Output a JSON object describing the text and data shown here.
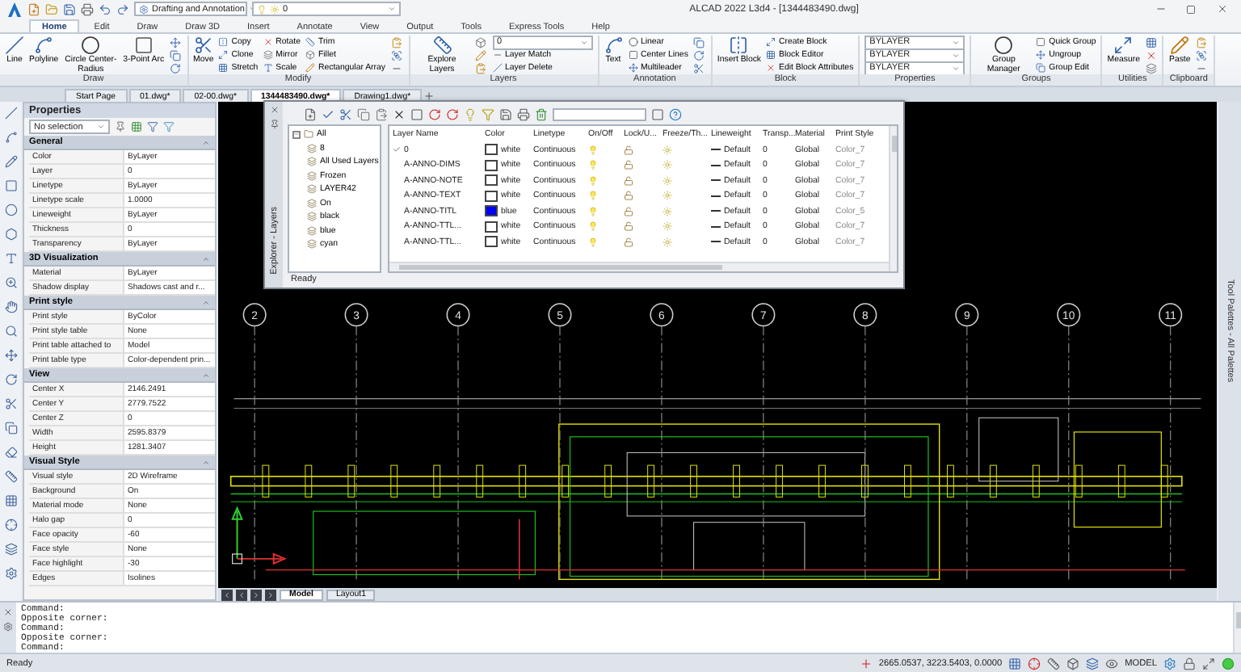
{
  "title_bar": {
    "workspace": "Drafting and Annotation",
    "layer": "0",
    "title": "ALCAD 2022 L3d4 - [1344483490.dwg]"
  },
  "menu_tabs": [
    {
      "label": "Home",
      "selected": true
    },
    {
      "label": "Edit",
      "selected": false
    },
    {
      "label": "Draw",
      "selected": false
    },
    {
      "label": "Draw 3D",
      "selected": false
    },
    {
      "label": "Insert",
      "selected": false
    },
    {
      "label": "Annotate",
      "selected": false
    },
    {
      "label": "View",
      "selected": false
    },
    {
      "label": "Output",
      "selected": false
    },
    {
      "label": "Tools",
      "selected": false
    },
    {
      "label": "Express Tools",
      "selected": false
    },
    {
      "label": "Help",
      "selected": false
    }
  ],
  "ribbon": [
    {
      "title": "Draw",
      "tools": [
        {
          "kind": "large",
          "label": "Line"
        },
        {
          "kind": "large",
          "label": "Polyline"
        },
        {
          "kind": "large",
          "label": "Circle Center-Radius"
        },
        {
          "kind": "large",
          "label": "3-Point Arc"
        },
        {
          "kind": "icon"
        },
        {
          "kind": "icon"
        },
        {
          "kind": "icon"
        }
      ]
    },
    {
      "title": "Modify",
      "tools": [
        {
          "kind": "large",
          "label": "Move"
        },
        {
          "kind": "small",
          "label": "Copy"
        },
        {
          "kind": "small",
          "label": "Clone"
        },
        {
          "kind": "small",
          "label": "Stretch"
        },
        {
          "kind": "small",
          "label": "Rotate"
        },
        {
          "kind": "small",
          "label": "Mirror"
        },
        {
          "kind": "small",
          "label": "Scale"
        },
        {
          "kind": "small",
          "label": "Trim"
        },
        {
          "kind": "small",
          "label": "Fillet"
        },
        {
          "kind": "small",
          "label": "Rectangular Array"
        },
        {
          "kind": "icon"
        },
        {
          "kind": "icon"
        },
        {
          "kind": "icon"
        }
      ]
    },
    {
      "title": "Layers",
      "tools": [
        {
          "kind": "large",
          "label": "Explore Layers"
        },
        {
          "kind": "icon"
        },
        {
          "kind": "icon"
        },
        {
          "kind": "icon"
        },
        {
          "kind": "dropdown",
          "label": "0"
        },
        {
          "kind": "small",
          "label": "Layer Match"
        },
        {
          "kind": "small",
          "label": "Layer Delete"
        }
      ]
    },
    {
      "title": "Annotation",
      "tools": [
        {
          "kind": "large",
          "label": "Text"
        },
        {
          "kind": "small",
          "label": "Linear"
        },
        {
          "kind": "small",
          "label": "Center Lines"
        },
        {
          "kind": "small",
          "label": "Multileader"
        },
        {
          "kind": "icon"
        },
        {
          "kind": "icon"
        },
        {
          "kind": "icon"
        }
      ]
    },
    {
      "title": "Block",
      "tools": [
        {
          "kind": "large",
          "label": "Insert Block"
        },
        {
          "kind": "small",
          "label": "Create Block"
        },
        {
          "kind": "small",
          "label": "Block Editor"
        },
        {
          "kind": "small",
          "label": "Edit Block Attributes"
        }
      ]
    },
    {
      "title": "Properties",
      "tools": [
        {
          "kind": "dropdown",
          "label": "BYLAYER"
        },
        {
          "kind": "dropdown",
          "label": "BYLAYER"
        },
        {
          "kind": "dropdown",
          "label": "BYLAYER"
        }
      ]
    },
    {
      "title": "Groups",
      "tools": [
        {
          "kind": "large",
          "label": "Group Manager"
        },
        {
          "kind": "small",
          "label": "Quick Group"
        },
        {
          "kind": "small",
          "label": "Ungroup"
        },
        {
          "kind": "small",
          "label": "Group Edit"
        }
      ]
    },
    {
      "title": "Utilities",
      "tools": [
        {
          "kind": "large",
          "label": "Measure"
        },
        {
          "kind": "icon"
        },
        {
          "kind": "icon"
        },
        {
          "kind": "icon"
        }
      ]
    },
    {
      "title": "Clipboard",
      "tools": [
        {
          "kind": "large",
          "label": "Paste"
        },
        {
          "kind": "icon"
        },
        {
          "kind": "icon"
        },
        {
          "kind": "icon"
        }
      ]
    }
  ],
  "doc_tabs": [
    {
      "label": "Start Page",
      "selected": false
    },
    {
      "label": "01.dwg*",
      "selected": false
    },
    {
      "label": "02-00.dwg*",
      "selected": false
    },
    {
      "label": "1344483490.dwg*",
      "selected": true
    },
    {
      "label": "Drawing1.dwg*",
      "selected": false
    }
  ],
  "properties": {
    "title": "Properties",
    "selection": "No selection",
    "sections": [
      {
        "title": "General",
        "expanded": true,
        "rows": [
          {
            "label": "Color",
            "value": "ByLayer"
          },
          {
            "label": "Layer",
            "value": "0"
          },
          {
            "label": "Linetype",
            "value": "ByLayer"
          },
          {
            "label": "Linetype scale",
            "value": "1.0000"
          },
          {
            "label": "Lineweight",
            "value": "ByLayer"
          },
          {
            "label": "Thickness",
            "value": "0"
          },
          {
            "label": "Transparency",
            "value": "ByLayer"
          }
        ]
      },
      {
        "title": "3D Visualization",
        "expanded": true,
        "rows": [
          {
            "label": "Material",
            "value": "ByLayer"
          },
          {
            "label": "Shadow display",
            "value": "Shadows cast and r..."
          }
        ]
      },
      {
        "title": "Print style",
        "expanded": true,
        "rows": [
          {
            "label": "Print style",
            "value": "ByColor"
          },
          {
            "label": "Print style table",
            "value": "None"
          },
          {
            "label": "Print table attached to",
            "value": "Model"
          },
          {
            "label": "Print table type",
            "value": "Color-dependent prin..."
          }
        ]
      },
      {
        "title": "View",
        "expanded": true,
        "rows": [
          {
            "label": "Center X",
            "value": "2146.2491"
          },
          {
            "label": "Center Y",
            "value": "2779.7522"
          },
          {
            "label": "Center Z",
            "value": "0"
          },
          {
            "label": "Width",
            "value": "2595.8379"
          },
          {
            "label": "Height",
            "value": "1281.3407"
          }
        ]
      },
      {
        "title": "Visual Style",
        "expanded": true,
        "rows": [
          {
            "label": "Visual style",
            "value": "2D Wireframe"
          },
          {
            "label": "Background",
            "value": "On"
          },
          {
            "label": "Material mode",
            "value": "None"
          },
          {
            "label": "Halo gap",
            "value": "0"
          },
          {
            "label": "Face opacity",
            "value": "-60"
          },
          {
            "label": "Face style",
            "value": "None"
          },
          {
            "label": "Face highlight",
            "value": "-30"
          },
          {
            "label": "Edges",
            "value": "Isolines"
          }
        ]
      }
    ]
  },
  "layer_explorer": {
    "side_title": "Explorer - Layers",
    "filters": [
      {
        "label": "All",
        "expanded": true,
        "children": [
          {
            "label": "8"
          },
          {
            "label": "All Used Layers"
          },
          {
            "label": "Frozen"
          },
          {
            "label": "LAYER42"
          },
          {
            "label": "On"
          },
          {
            "label": "black"
          },
          {
            "label": "blue"
          },
          {
            "label": "cyan"
          }
        ]
      }
    ],
    "columns": [
      "Layer Name",
      "Color",
      "Linetype",
      "On/Off",
      "Lock/U...",
      "Freeze/Th...",
      "Lineweight",
      "Transp...",
      "Material",
      "Print Style"
    ],
    "rows": [
      {
        "name": "0",
        "current": true,
        "color": "#ffffff",
        "color_name": "white",
        "linetype": "Continuous",
        "on": true,
        "locked": false,
        "frozen": false,
        "lineweight": "Default",
        "transparency": "0",
        "material": "Global",
        "print_style": "Color_7"
      },
      {
        "name": "A-ANNO-DIMS",
        "current": false,
        "color": "#ffffff",
        "color_name": "white",
        "linetype": "Continuous",
        "on": true,
        "locked": false,
        "frozen": false,
        "lineweight": "Default",
        "transparency": "0",
        "material": "Global",
        "print_style": "Color_7"
      },
      {
        "name": "A-ANNO-NOTE",
        "current": false,
        "color": "#ffffff",
        "color_name": "white",
        "linetype": "Continuous",
        "on": true,
        "locked": false,
        "frozen": false,
        "lineweight": "Default",
        "transparency": "0",
        "material": "Global",
        "print_style": "Color_7"
      },
      {
        "name": "A-ANNO-TEXT",
        "current": false,
        "color": "#ffffff",
        "color_name": "white",
        "linetype": "Continuous",
        "on": true,
        "locked": false,
        "frozen": false,
        "lineweight": "Default",
        "transparency": "0",
        "material": "Global",
        "print_style": "Color_7"
      },
      {
        "name": "A-ANNO-TITL",
        "current": false,
        "color": "#0000ff",
        "color_name": "blue",
        "linetype": "Continuous",
        "on": true,
        "locked": false,
        "frozen": false,
        "lineweight": "Default",
        "transparency": "0",
        "material": "Global",
        "print_style": "Color_5"
      },
      {
        "name": "A-ANNO-TTL...",
        "current": false,
        "color": "#ffffff",
        "color_name": "white",
        "linetype": "Continuous",
        "on": true,
        "locked": false,
        "frozen": false,
        "lineweight": "Default",
        "transparency": "0",
        "material": "Global",
        "print_style": "Color_7"
      },
      {
        "name": "A-ANNO-TTL...",
        "current": false,
        "color": "#ffffff",
        "color_name": "white",
        "linetype": "Continuous",
        "on": true,
        "locked": false,
        "frozen": false,
        "lineweight": "Default",
        "transparency": "0",
        "material": "Global",
        "print_style": "Color_7"
      }
    ],
    "status": "Ready"
  },
  "drawing": {
    "grid_labels": [
      "2",
      "3",
      "4",
      "5",
      "6",
      "7",
      "8",
      "9",
      "10",
      "11"
    ]
  },
  "tool_palette": {
    "title": "Tool Palettes - All Palettes"
  },
  "layout_tabs": [
    {
      "label": "Model",
      "selected": true
    },
    {
      "label": "Layout1",
      "selected": false
    }
  ],
  "command": {
    "history": [
      "Command:",
      "Opposite corner:",
      "Command:",
      "Opposite corner:",
      "Command:"
    ]
  },
  "status_bar": {
    "state": "Ready",
    "coordinates": "2665.0537, 3223.5403, 0.0000",
    "space": "MODEL"
  }
}
